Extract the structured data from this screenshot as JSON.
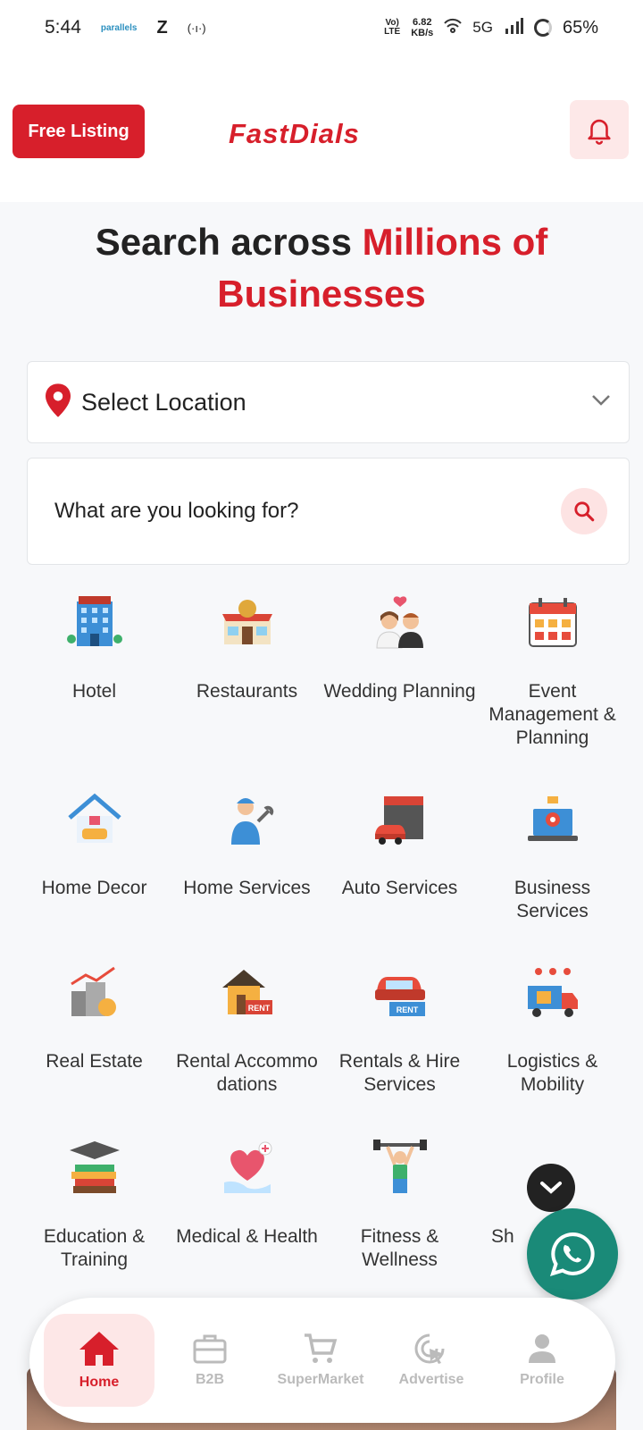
{
  "status_bar": {
    "time": "5:44",
    "mini_icon_text": "parallels",
    "z_icon": "Z",
    "hotspot": "(·ı·)",
    "volte_top": "Vo)",
    "volte_bottom": "LTE",
    "speed_top": "6.82",
    "speed_bottom": "KB/s",
    "network": "5G",
    "battery": "65%"
  },
  "header": {
    "free_listing_label": "Free Listing",
    "logo_text": "FastDials"
  },
  "hero": {
    "line1_black": "Search across ",
    "line1_red": "Millions of",
    "line2_red": "Businesses"
  },
  "location": {
    "label": "Select Location"
  },
  "search": {
    "placeholder": "What are you looking for?"
  },
  "categories": [
    {
      "label": "Hotel",
      "icon": "hotel-icon"
    },
    {
      "label": "Restaurants",
      "icon": "restaurant-icon"
    },
    {
      "label": "Wedding Planning",
      "icon": "wedding-icon"
    },
    {
      "label": "Event Management & Planning",
      "icon": "calendar-icon"
    },
    {
      "label": "Home Decor",
      "icon": "home-decor-icon"
    },
    {
      "label": "Home Services",
      "icon": "mechanic-icon"
    },
    {
      "label": "Auto Services",
      "icon": "garage-icon"
    },
    {
      "label": "Business Services",
      "icon": "laptop-gear-icon"
    },
    {
      "label": "Real Estate",
      "icon": "building-growth-icon"
    },
    {
      "label": "Rental Accommo dations",
      "icon": "house-rent-icon"
    },
    {
      "label": "Rentals & Hire Services",
      "icon": "car-rent-icon"
    },
    {
      "label": "Logistics & Mobility",
      "icon": "truck-icon"
    },
    {
      "label": "Education & Training",
      "icon": "books-icon"
    },
    {
      "label": "Medical & Health",
      "icon": "heart-hand-icon"
    },
    {
      "label": "Fitness & Wellness",
      "icon": "weightlifter-icon"
    },
    {
      "label": "Sh",
      "icon": "shopping-icon"
    }
  ],
  "bottom_nav": [
    {
      "label": "Home",
      "icon": "home-icon",
      "active": true
    },
    {
      "label": "B2B",
      "icon": "briefcase-icon",
      "active": false
    },
    {
      "label": "SuperMarket",
      "icon": "cart-icon",
      "active": false
    },
    {
      "label": "Advertise",
      "icon": "cursor-click-icon",
      "active": false
    },
    {
      "label": "Profile",
      "icon": "person-icon",
      "active": false
    }
  ],
  "colors": {
    "brand_red": "#d71f2b",
    "whatsapp_green": "#1a8a78",
    "light_pink": "#fde8e8"
  }
}
